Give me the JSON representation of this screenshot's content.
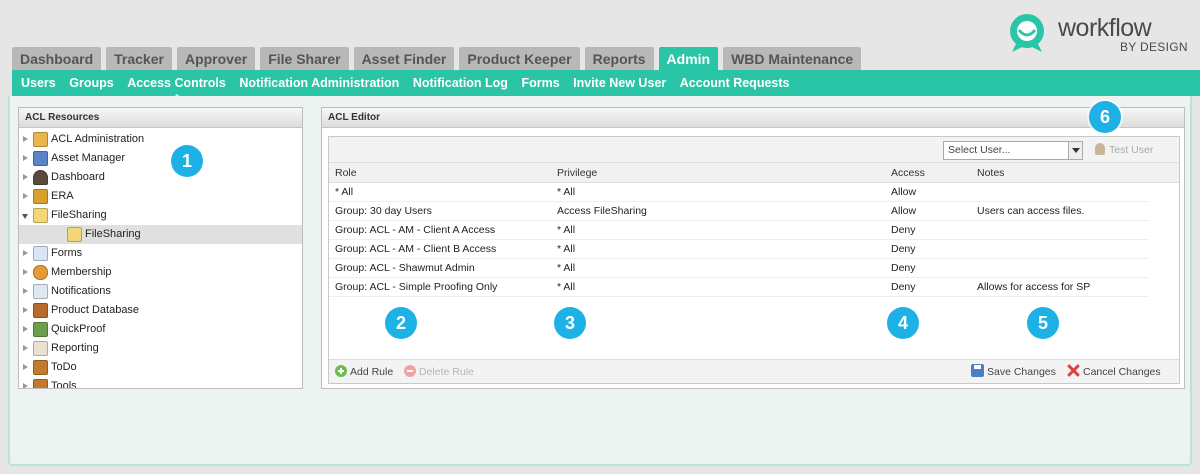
{
  "logo": {
    "name": "workflow",
    "sub": "BY DESIGN"
  },
  "tabs": [
    {
      "label": "Dashboard",
      "active": false
    },
    {
      "label": "Tracker",
      "active": false
    },
    {
      "label": "Approver",
      "active": false
    },
    {
      "label": "File Sharer",
      "active": false
    },
    {
      "label": "Asset Finder",
      "active": false
    },
    {
      "label": "Product Keeper",
      "active": false
    },
    {
      "label": "Reports",
      "active": false
    },
    {
      "label": "Admin",
      "active": true
    },
    {
      "label": "WBD Maintenance",
      "active": false
    }
  ],
  "subnav": [
    {
      "label": "Users",
      "active": false
    },
    {
      "label": "Groups",
      "active": false
    },
    {
      "label": "Access Controls",
      "active": true
    },
    {
      "label": "Notification Administration",
      "active": false
    },
    {
      "label": "Notification Log",
      "active": false
    },
    {
      "label": "Forms",
      "active": false
    },
    {
      "label": "Invite New User",
      "active": false
    },
    {
      "label": "Account Requests",
      "active": false
    }
  ],
  "acl_resources": {
    "title": "ACL Resources",
    "items": [
      {
        "label": "ACL Administration",
        "icon": "lock-icon",
        "color": "#e8b64a"
      },
      {
        "label": "Asset Manager",
        "icon": "monitor-icon",
        "color": "#5b83c8"
      },
      {
        "label": "Dashboard",
        "icon": "gauge-icon",
        "color": "#5a4a3a"
      },
      {
        "label": "ERA",
        "icon": "era-icon",
        "color": "#d9a02c"
      },
      {
        "label": "FileSharing",
        "icon": "folder-icon",
        "color": "#f4d774",
        "expanded": true
      },
      {
        "label": "FileSharing",
        "icon": "folder-icon",
        "color": "#f4d774",
        "child": true,
        "selected": true
      },
      {
        "label": "Forms",
        "icon": "form-icon",
        "color": "#d9e6f5"
      },
      {
        "label": "Membership",
        "icon": "people-icon",
        "color": "#e59a3a"
      },
      {
        "label": "Notifications",
        "icon": "mail-icon",
        "color": "#dfe7f1"
      },
      {
        "label": "Product Database",
        "icon": "book-icon",
        "color": "#b86a2c"
      },
      {
        "label": "QuickProof",
        "icon": "proof-icon",
        "color": "#6d9f4c"
      },
      {
        "label": "Reporting",
        "icon": "report-icon",
        "color": "#e9e2d0"
      },
      {
        "label": "ToDo",
        "icon": "todo-icon",
        "color": "#c47a2e"
      },
      {
        "label": "Tools",
        "icon": "tools-icon",
        "color": "#c47a2e"
      }
    ]
  },
  "acl_editor": {
    "title": "ACL Editor",
    "select_user_placeholder": "Select User...",
    "test_user_label": "Test User",
    "columns": {
      "role": "Role",
      "privilege": "Privilege",
      "access": "Access",
      "notes": "Notes"
    },
    "rows": [
      {
        "role": "* All",
        "privilege": "* All",
        "access": "Allow",
        "notes": ""
      },
      {
        "role": "Group: 30 day Users",
        "privilege": "Access FileSharing",
        "access": "Allow",
        "notes": "Users can access files."
      },
      {
        "role": "Group: ACL - AM - Client A Access",
        "privilege": "* All",
        "access": "Deny",
        "notes": ""
      },
      {
        "role": "Group: ACL - AM - Client B Access",
        "privilege": "* All",
        "access": "Deny",
        "notes": ""
      },
      {
        "role": "Group: ACL - Shawmut Admin",
        "privilege": "* All",
        "access": "Deny",
        "notes": ""
      },
      {
        "role": "Group: ACL - Simple Proofing Only",
        "privilege": "* All",
        "access": "Deny",
        "notes": "Allows for access for SP"
      }
    ],
    "add_rule": "Add Rule",
    "delete_rule": "Delete Rule",
    "save_changes": "Save Changes",
    "cancel_changes": "Cancel Changes"
  },
  "badges": [
    "1",
    "2",
    "3",
    "4",
    "5",
    "6"
  ],
  "colors": {
    "accent": "#29c5a6",
    "badge": "#1eb1e6",
    "tab_inactive": "#b8b8b8"
  }
}
